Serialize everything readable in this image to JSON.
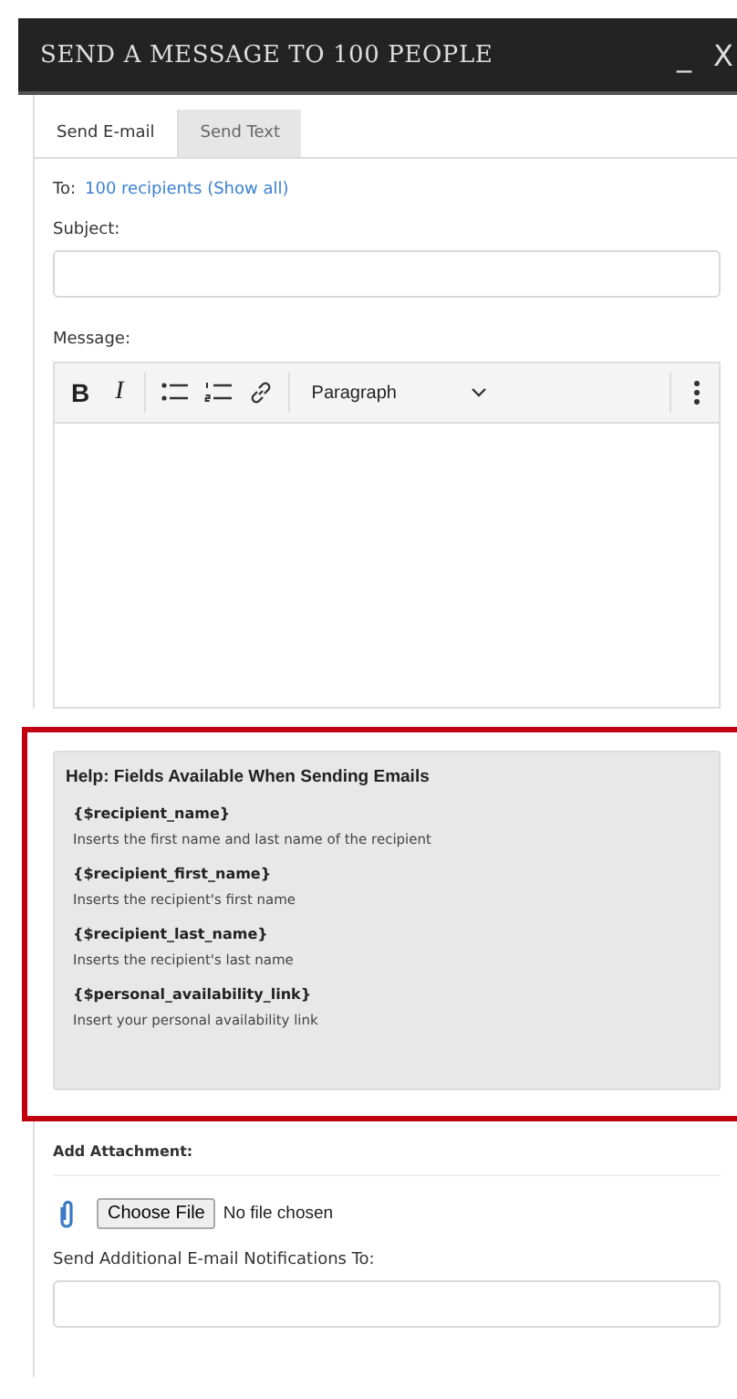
{
  "window": {
    "title": "SEND A MESSAGE TO 100 PEOPLE",
    "minimize": "_",
    "close": "X"
  },
  "tabs": [
    {
      "label": "Send E-mail",
      "selected": true
    },
    {
      "label": "Send Text",
      "selected": false
    }
  ],
  "to": {
    "label": "To:",
    "link": "100 recipients (Show all)"
  },
  "subject": {
    "label": "Subject:"
  },
  "message": {
    "label": "Message:",
    "toolbar": {
      "bold": "B",
      "italic": "I",
      "format": "Paragraph"
    }
  },
  "help": {
    "title": "Help: Fields Available When Sending Emails",
    "fields": [
      {
        "code": "{$recipient_name}",
        "description": "Inserts the first name and last name of the recipient"
      },
      {
        "code": "{$recipient_first_name}",
        "description": "Inserts the recipient's first name"
      },
      {
        "code": "{$recipient_last_name}",
        "description": "Inserts the recipient's last name"
      },
      {
        "code": "{$personal_availability_link}",
        "description": "Insert your personal availability link"
      }
    ]
  },
  "attachment": {
    "label": "Add Attachment:",
    "button": "Choose File",
    "status": "No file chosen"
  },
  "notifications": {
    "label": "Send Additional E-mail Notifications To:"
  }
}
